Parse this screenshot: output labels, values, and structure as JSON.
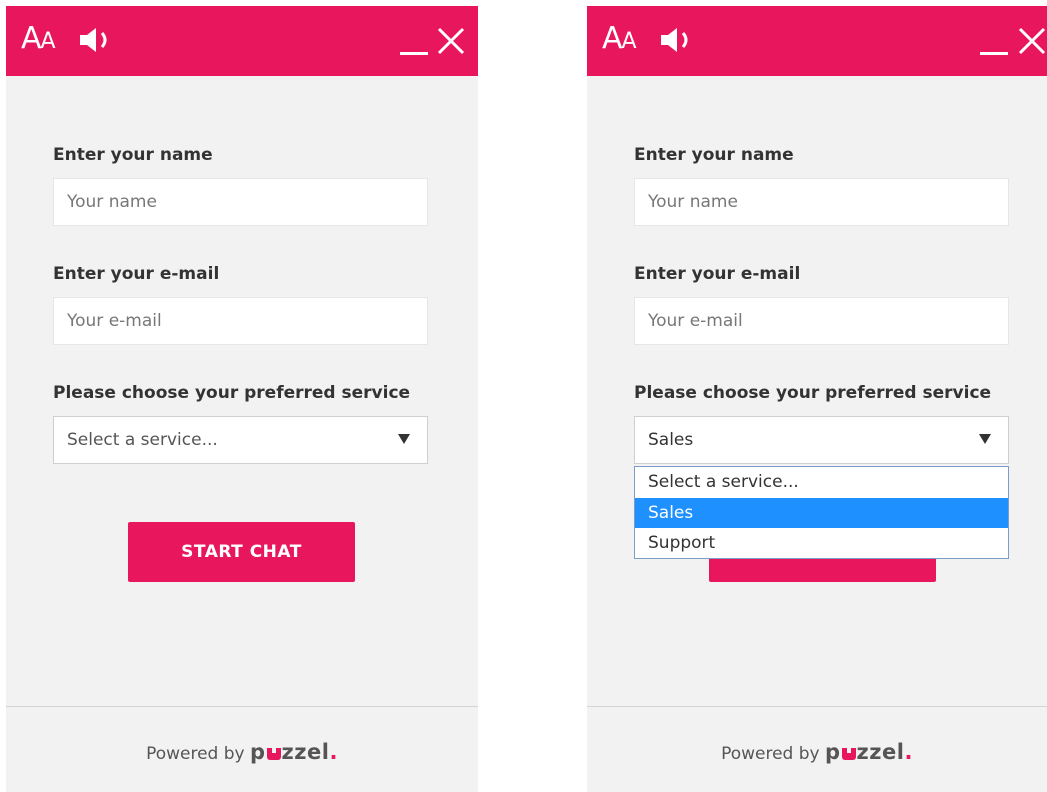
{
  "colors": {
    "brand": "#e8175d",
    "panel_bg": "#f2f2f2",
    "selected_option_bg": "#1e90ff"
  },
  "header": {
    "text_size_icon": "AA",
    "icons": [
      "text-size-icon",
      "speaker-icon",
      "minimize-icon",
      "close-icon"
    ]
  },
  "form": {
    "name_label": "Enter your name",
    "name_placeholder": "Your name",
    "email_label": "Enter your e-mail",
    "email_placeholder": "Your e-mail",
    "service_label": "Please choose your preferred service",
    "service_placeholder": "Select a service...",
    "start_button": "START CHAT"
  },
  "right_panel": {
    "selected_service": "Sales",
    "options": [
      "Select a service...",
      "Sales",
      "Support"
    ],
    "highlighted_index": 1
  },
  "footer": {
    "powered_by": "Powered by",
    "brand": "puzzel"
  }
}
